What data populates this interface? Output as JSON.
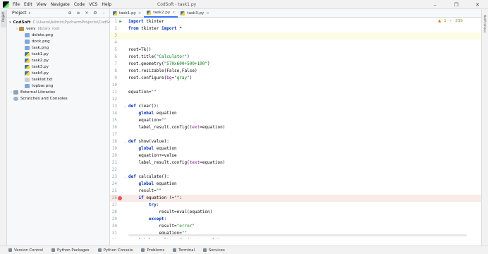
{
  "titlebar": {
    "menu": [
      "File",
      "Edit",
      "View",
      "Navigate",
      "Code",
      "VCS",
      "Help"
    ],
    "window_title": "CodSoft - task1.py"
  },
  "left_stripe": {
    "project_tab": "Project"
  },
  "right_stripe": {
    "notifications": "Notifications"
  },
  "project_panel": {
    "title": "Project",
    "tree": [
      {
        "label": "CodSoft",
        "path": "C:\\Users\\Admin\\PycharmProjects\\CodSoft",
        "type": "folder",
        "indent": 0,
        "arrow": "▾",
        "bold": true
      },
      {
        "label": "venv",
        "path": "library root",
        "type": "folder-dark",
        "indent": 1,
        "arrow": "›",
        "bold": false
      },
      {
        "label": "delete.png",
        "path": "",
        "type": "png",
        "indent": 2,
        "arrow": "",
        "bold": false
      },
      {
        "label": "dock.png",
        "path": "",
        "type": "png",
        "indent": 2,
        "arrow": "",
        "bold": false
      },
      {
        "label": "task.png",
        "path": "",
        "type": "png",
        "indent": 2,
        "arrow": "",
        "bold": false
      },
      {
        "label": "task1.py",
        "path": "",
        "type": "py",
        "indent": 2,
        "arrow": "",
        "bold": false
      },
      {
        "label": "task2.py",
        "path": "",
        "type": "py",
        "indent": 2,
        "arrow": "",
        "bold": false
      },
      {
        "label": "task3.py",
        "path": "",
        "type": "py",
        "indent": 2,
        "arrow": "",
        "bold": false
      },
      {
        "label": "task4.py",
        "path": "",
        "type": "py",
        "indent": 2,
        "arrow": "",
        "bold": false
      },
      {
        "label": "tasklist.txt",
        "path": "",
        "type": "txt",
        "indent": 2,
        "arrow": "",
        "bold": false
      },
      {
        "label": "topbar.png",
        "path": "",
        "type": "png",
        "indent": 2,
        "arrow": "",
        "bold": false
      },
      {
        "label": "External Libraries",
        "path": "",
        "type": "lib",
        "indent": 0,
        "arrow": "›",
        "bold": false
      },
      {
        "label": "Scratches and Consoles",
        "path": "",
        "type": "scr",
        "indent": 0,
        "arrow": "",
        "bold": false
      }
    ]
  },
  "tabs": [
    {
      "label": "task1.py",
      "active": false
    },
    {
      "label": "task2.py",
      "active": true
    },
    {
      "label": "task3.py",
      "active": false
    }
  ],
  "inspections": {
    "warnings": "1",
    "weak": "239"
  },
  "editor": {
    "lines": [
      {
        "n": "1",
        "text": "import tkinter",
        "mark": "run"
      },
      {
        "n": "2",
        "text": "from tkinter import *",
        "mark": ""
      },
      {
        "n": "3",
        "text": "",
        "mark": "current"
      },
      {
        "n": "4",
        "text": "",
        "mark": ""
      },
      {
        "n": "5",
        "text": "root=Tk()",
        "mark": ""
      },
      {
        "n": "6",
        "text": "root.title(\"Calculator\")",
        "mark": ""
      },
      {
        "n": "7",
        "text": "root.geometry(\"570x600+500+100\")",
        "mark": ""
      },
      {
        "n": "8",
        "text": "root.resizable(False,False)",
        "mark": ""
      },
      {
        "n": "9",
        "text": "root.configure(bg=\"gray\")",
        "mark": ""
      },
      {
        "n": "10",
        "text": "",
        "mark": ""
      },
      {
        "n": "11",
        "text": "equation=\"\"",
        "mark": ""
      },
      {
        "n": "12",
        "text": "",
        "mark": ""
      },
      {
        "n": "13",
        "text": "def clear():",
        "mark": ""
      },
      {
        "n": "14",
        "text": "    global equation",
        "mark": ""
      },
      {
        "n": "15",
        "text": "    equation=\"\"",
        "mark": ""
      },
      {
        "n": "16",
        "text": "    label_result.config(text=equation)",
        "mark": ""
      },
      {
        "n": "17",
        "text": "",
        "mark": ""
      },
      {
        "n": "18",
        "text": "def show(value):",
        "mark": ""
      },
      {
        "n": "19",
        "text": "    global equation",
        "mark": ""
      },
      {
        "n": "20",
        "text": "    equation+=value",
        "mark": ""
      },
      {
        "n": "21",
        "text": "    label_result.config(text=equation)",
        "mark": ""
      },
      {
        "n": "22",
        "text": "",
        "mark": ""
      },
      {
        "n": "23",
        "text": "def calculate():",
        "mark": ""
      },
      {
        "n": "24",
        "text": "    global equation",
        "mark": ""
      },
      {
        "n": "25",
        "text": "    result=\"\"",
        "mark": ""
      },
      {
        "n": "26",
        "text": "    if equation !=\"\":",
        "mark": "breakpoint"
      },
      {
        "n": "27",
        "text": "        try:",
        "mark": ""
      },
      {
        "n": "28",
        "text": "            result=eval(equation)",
        "mark": ""
      },
      {
        "n": "29",
        "text": "        except:",
        "mark": ""
      },
      {
        "n": "30",
        "text": "            result=\"error\"",
        "mark": ""
      },
      {
        "n": "31",
        "text": "            equation=\"\"",
        "mark": ""
      },
      {
        "n": "32",
        "text": "    label_result.config(text=result)",
        "mark": ""
      }
    ]
  },
  "statusbar": {
    "items": [
      "Version Control",
      "Python Packages",
      "Python Console",
      "Problems",
      "Terminal",
      "Services"
    ]
  },
  "colors": {
    "keyword": "#0033b3",
    "string": "#067d17",
    "param": "#871094",
    "breakpoint": "#e55757",
    "accent": "#3574f0"
  }
}
